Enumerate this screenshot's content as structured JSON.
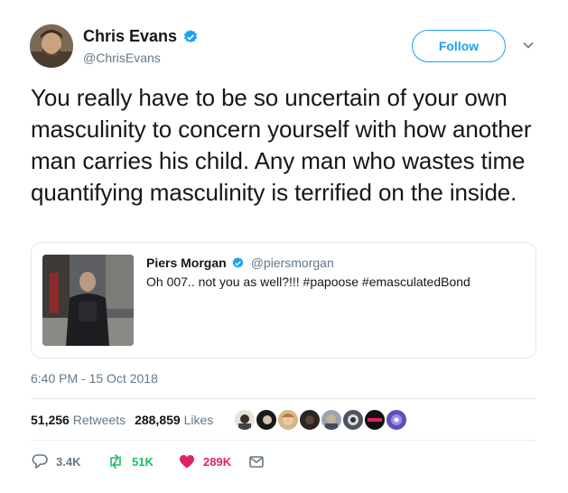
{
  "author": {
    "name": "Chris Evans",
    "handle": "@ChrisEvans"
  },
  "follow_label": "Follow",
  "tweet": {
    "text": "You really have to be so uncertain of your own masculinity to concern yourself with how another man carries his child. Any man who wastes time quantifying masculinity is terrified on the inside."
  },
  "quoted": {
    "name": "Piers Morgan",
    "handle": "@piersmorgan",
    "text": "Oh 007.. not you as well?!!! #papoose #emasculatedBond"
  },
  "timestamp": "6:40 PM - 15 Oct 2018",
  "stats": {
    "retweets_count": "51,256",
    "retweets_label": "Retweets",
    "likes_count": "288,859",
    "likes_label": "Likes"
  },
  "actions": {
    "replies": "3.4K",
    "retweets": "51K",
    "likes": "289K"
  },
  "colors": {
    "accent": "#1da1f2",
    "retweet": "#17bf63",
    "like": "#e0245e",
    "muted": "#657786"
  },
  "icons": [
    "verified-badge-icon",
    "chevron-down-icon",
    "reply-icon",
    "retweet-icon",
    "heart-icon",
    "message-icon"
  ]
}
